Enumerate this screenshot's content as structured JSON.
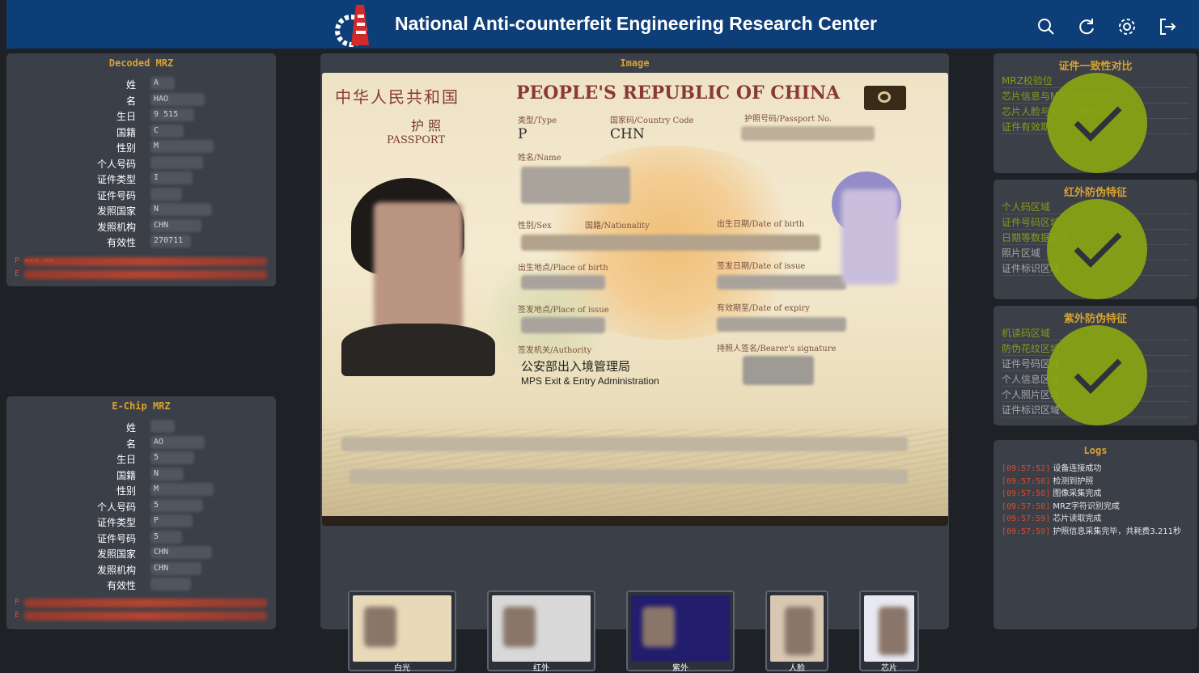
{
  "header": {
    "title": "National Anti-counterfeit Engineering Research Center",
    "icons": [
      "search-icon",
      "refresh-icon",
      "settings-icon",
      "logout-icon"
    ]
  },
  "decoded": {
    "title": "Decoded MRZ",
    "rows": [
      {
        "label": "姓",
        "value": "A"
      },
      {
        "label": "名",
        "value": "HAO"
      },
      {
        "label": "生日",
        "value": "9   515"
      },
      {
        "label": "国籍",
        "value": "C"
      },
      {
        "label": "性别",
        "value": "M"
      },
      {
        "label": "个人号码",
        "value": ""
      },
      {
        "label": "证件类型",
        "value": "I"
      },
      {
        "label": "证件号码",
        "value": ""
      },
      {
        "label": "发照国家",
        "value": "N"
      },
      {
        "label": "发照机构",
        "value": "CHN"
      },
      {
        "label": "有效性",
        "value": "270711"
      }
    ],
    "mrz1": "P                                     <<< <<",
    "mrz2": "E"
  },
  "echip": {
    "title": "E-Chip MRZ",
    "rows": [
      {
        "label": "姓",
        "value": ""
      },
      {
        "label": "名",
        "value": "AO"
      },
      {
        "label": "生日",
        "value": "5"
      },
      {
        "label": "国籍",
        "value": "N"
      },
      {
        "label": "性别",
        "value": "M"
      },
      {
        "label": "个人号码",
        "value": "5"
      },
      {
        "label": "证件类型",
        "value": "P"
      },
      {
        "label": "证件号码",
        "value": "5"
      },
      {
        "label": "发照国家",
        "value": "CHN"
      },
      {
        "label": "发照机构",
        "value": "CHN"
      },
      {
        "label": "有效性",
        "value": ""
      }
    ],
    "mrz1": "P",
    "mrz2": "E"
  },
  "image": {
    "title": "Image",
    "passport": {
      "cn_title": "中华人民共和国",
      "en_title": "PEOPLE'S REPUBLIC OF CHINA",
      "doc_cn": "护 照",
      "doc_en": "PASSPORT",
      "type_label": "类型/Type",
      "type_value": "P",
      "code_label": "国家码/Country Code",
      "code_value": "CHN",
      "no_label": "护照号码/Passport No.",
      "name_label": "姓名/Name",
      "sex_label": "性别/Sex",
      "nat_label": "国籍/Nationality",
      "dob_label": "出生日期/Date of birth",
      "pob_label": "出生地点/Place of birth",
      "doi_label": "签发日期/Date of issue",
      "poi_label": "签发地点/Place of issue",
      "doe_label": "有效期至/Date of expiry",
      "auth_label": "签发机关/Authority",
      "auth_cn": "公安部出入境管理局",
      "auth_en": "MPS Exit & Entry Administration",
      "sig_label": "持照人签名/Bearer's signature"
    },
    "thumbs": [
      "白光",
      "红外",
      "紫外",
      "人脸",
      "芯片"
    ]
  },
  "consistency": {
    "title": "证件一致性对比",
    "items": [
      "MRZ校验位",
      "芯片信息与MRZ信息比对",
      "芯片人脸与照片人脸比对",
      "证件有效期"
    ]
  },
  "ir": {
    "title": "红外防伪特征",
    "items": [
      "个人码区域",
      "证件号码区域",
      "日期等数据区域",
      "照片区域",
      "证件标识区域"
    ]
  },
  "uv": {
    "title": "紫外防伪特征",
    "items": [
      "机读码区域",
      "防伪花纹区域",
      "证件号码区域",
      "个人信息区域",
      "个人照片区域",
      "证件标识区域"
    ]
  },
  "logs": {
    "title": "Logs",
    "entries": [
      {
        "time": "[09:57:52]",
        "msg": "设备连接成功"
      },
      {
        "time": "[09:57:58]",
        "msg": "检测到护照"
      },
      {
        "time": "[09:57:58]",
        "msg": "图像采集完成"
      },
      {
        "time": "[09:57:58]",
        "msg": "MRZ字符识别完成"
      },
      {
        "time": "[09:57:59]",
        "msg": "芯片读取完成"
      },
      {
        "time": "[09:57:59]",
        "msg": "护照信息采集完毕，共耗费3.211秒"
      }
    ]
  },
  "colors": {
    "accent": "#d8a233",
    "header": "#0d3e78",
    "ok": "#8aa513",
    "error": "#d94b2e"
  }
}
